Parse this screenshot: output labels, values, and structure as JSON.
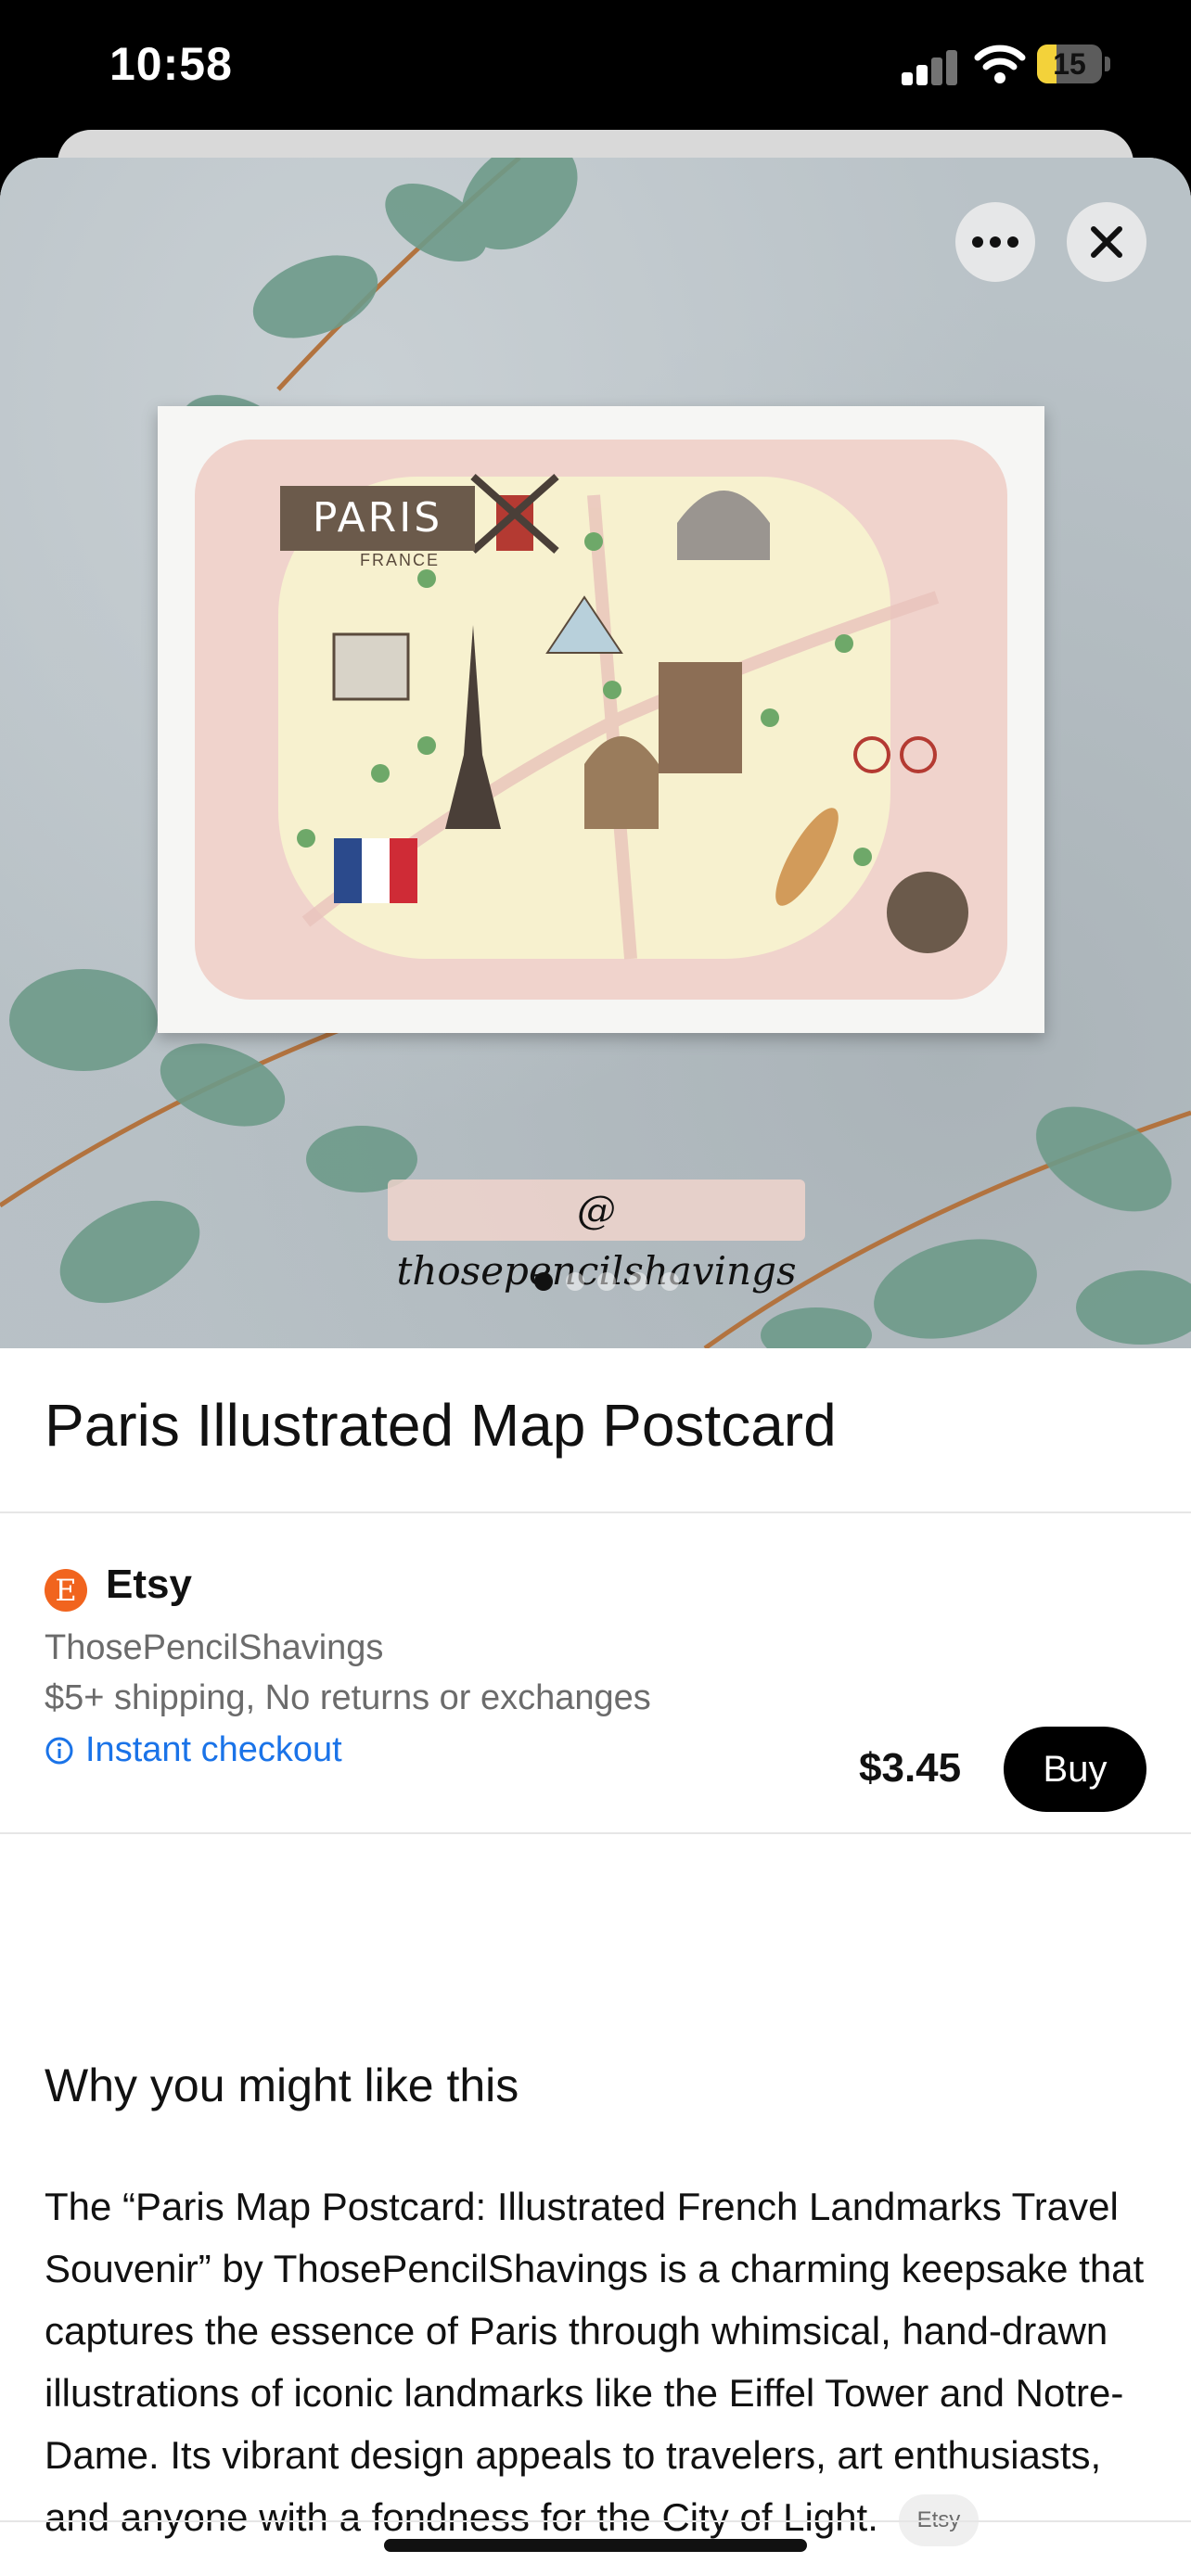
{
  "status_bar": {
    "time": "10:58",
    "battery_level": "15"
  },
  "hero": {
    "map_banner_text": "PARIS",
    "map_subtitle": "FRANCE",
    "watermark": "@ thosepencilshavings",
    "carousel_dots": 5,
    "active_dot": 0
  },
  "product": {
    "title": "Paris Illustrated Map Postcard"
  },
  "merchant": {
    "logo_letter": "E",
    "name": "Etsy",
    "seller": "ThosePencilShavings",
    "shipping": "$5+ shipping, No returns or exchanges",
    "checkout_label": "Instant checkout",
    "price": "$3.45",
    "buy_label": "Buy"
  },
  "why": {
    "heading": "Why you might like this",
    "body": "The “Paris Map Postcard: Illustrated French Landmarks Travel Souvenir” by ThosePencilShavings is a charming keepsake that captures the essence of Paris through whimsical, hand-drawn illustrations of iconic landmarks like the Eiffel Tower and Notre-Dame. Its vibrant design appeals to travelers, art enthusiasts, and anyone with a fondness for the City of Light.",
    "source_badge": "Etsy"
  },
  "colors": {
    "etsy_orange": "#f1641e",
    "link_blue": "#1a73e8",
    "battery_yellow": "#f3d23a"
  },
  "icons": [
    "signal-icon",
    "wifi-icon",
    "battery-icon",
    "more-icon",
    "close-icon",
    "etsy-logo-icon",
    "info-icon"
  ]
}
